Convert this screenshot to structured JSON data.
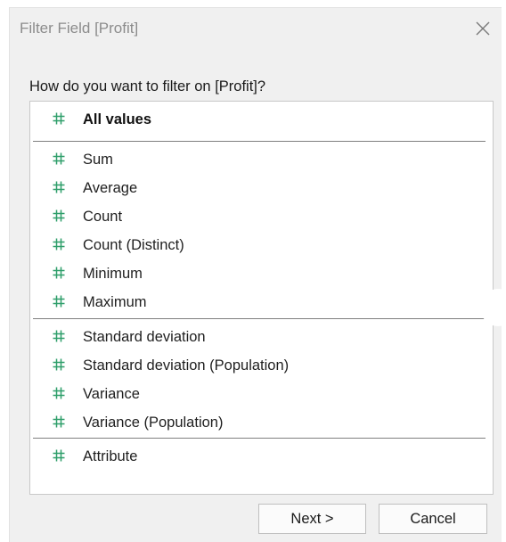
{
  "dialog": {
    "title": "Filter Field [Profit]",
    "close_icon": "close-icon",
    "prompt": "How do you want to filter on [Profit]?"
  },
  "options": [
    {
      "label": "All values",
      "icon": "measure-hash-icon",
      "bold": true
    },
    {
      "label": "Sum",
      "icon": "measure-hash-icon"
    },
    {
      "label": "Average",
      "icon": "measure-hash-icon"
    },
    {
      "label": "Count",
      "icon": "measure-hash-icon"
    },
    {
      "label": "Count (Distinct)",
      "icon": "measure-hash-icon"
    },
    {
      "label": "Minimum",
      "icon": "measure-hash-icon"
    },
    {
      "label": "Maximum",
      "icon": "measure-hash-icon"
    },
    {
      "label": "Standard deviation",
      "icon": "measure-hash-icon"
    },
    {
      "label": "Standard deviation (Population)",
      "icon": "measure-hash-icon"
    },
    {
      "label": "Variance",
      "icon": "measure-hash-icon"
    },
    {
      "label": "Variance (Population)",
      "icon": "measure-hash-icon"
    },
    {
      "label": "Attribute",
      "icon": "measure-hash-icon"
    }
  ],
  "buttons": {
    "next_label": "Next >",
    "cancel_label": "Cancel"
  },
  "colors": {
    "dialog_background": "#f0f0f0",
    "list_background": "#ffffff",
    "measure_icon": "#2e9e6a",
    "title_text": "#8c8c8c"
  }
}
